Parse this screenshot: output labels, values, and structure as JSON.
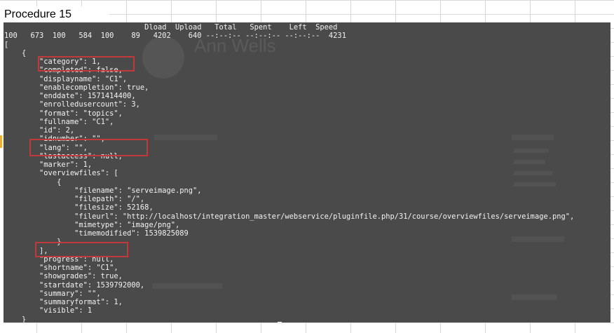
{
  "sheet": {
    "title": "Procedure 15"
  },
  "terminal": {
    "lines": [
      "                                Dload  Upload   Total   Spent    Left  Speed",
      "100   673  100   584  100    89   4202    640 --:--:-- --:--:-- --:--:--  4231",
      "[",
      "    {",
      "        \"category\": 1,",
      "        \"completed\": false,",
      "        \"displayname\": \"C1\",",
      "        \"enablecompletion\": true,",
      "        \"enddate\": 1571414400,",
      "        \"enrolledusercount\": 3,",
      "        \"format\": \"topics\",",
      "        \"fullname\": \"C1\",",
      "        \"id\": 2,",
      "        \"idnumber\": \"\",",
      "        \"lang\": \"\",",
      "        \"lastaccess\": null,",
      "        \"marker\": 1,",
      "        \"overviewfiles\": [",
      "            {",
      "                \"filename\": \"serveimage.png\",",
      "                \"filepath\": \"/\",",
      "                \"filesize\": 52168,",
      "                \"fileurl\": \"http://localhost/integration_master/webservice/pluginfile.php/31/course/overviewfiles/serveimage.png\",",
      "                \"mimetype\": \"image/png\",",
      "                \"timemodified\": 1539825089",
      "            }",
      "        ],",
      "        \"progress\": null,",
      "        \"shortname\": \"C1\",",
      "        \"showgrades\": true,",
      "        \"startdate\": 1539792000,",
      "        \"summary\": \"\",",
      "        \"summaryformat\": 1,",
      "        \"visible\": 1",
      "    }",
      "]"
    ]
  },
  "background_page": {
    "user_name": "Ann Wells"
  },
  "colors": {
    "terminal_bg": "#4a4a4a",
    "terminal_fg": "#f2f2f2",
    "highlight_box": "#c0393b",
    "grid": "#d9d9d9"
  }
}
